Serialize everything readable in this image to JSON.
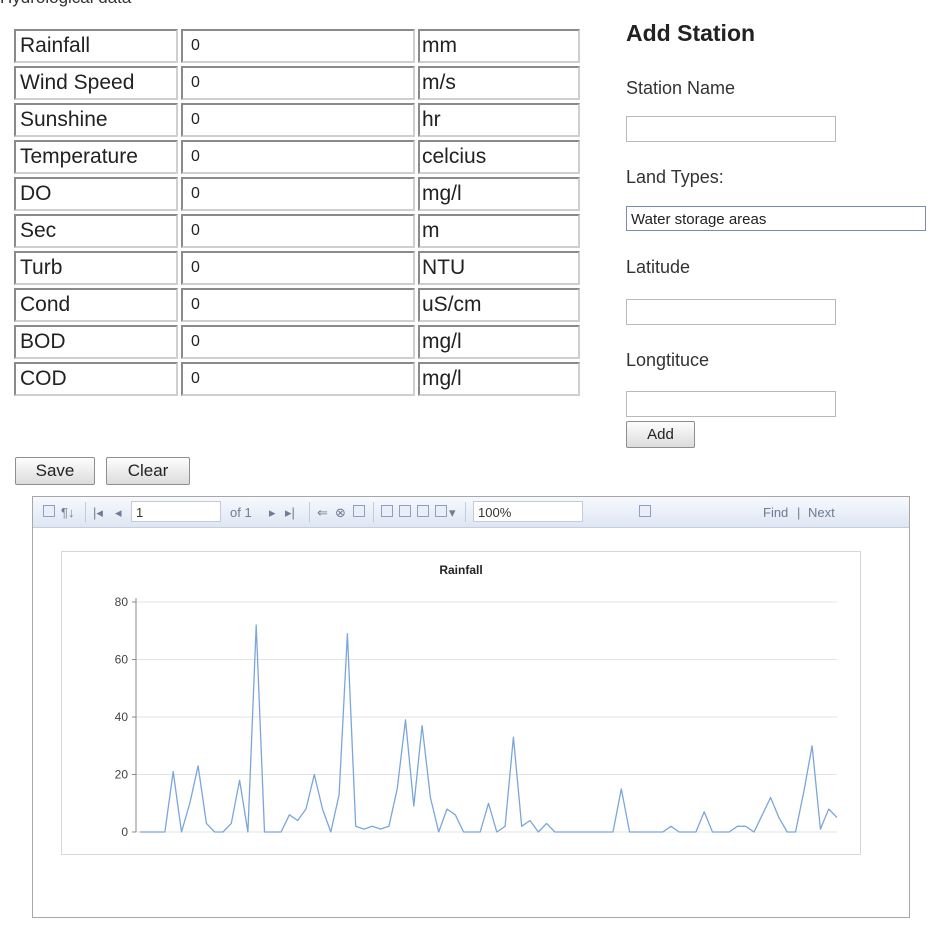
{
  "page": {
    "heading": "Hydrological data"
  },
  "parameters": [
    {
      "name": "Rainfall",
      "value": "0",
      "unit": "mm"
    },
    {
      "name": "Wind Speed",
      "value": "0",
      "unit": "m/s"
    },
    {
      "name": "Sunshine",
      "value": "0",
      "unit": "hr"
    },
    {
      "name": "Temperature",
      "value": "0",
      "unit": "celcius"
    },
    {
      "name": "DO",
      "value": "0",
      "unit": "mg/l"
    },
    {
      "name": "Sec",
      "value": "0",
      "unit": "m"
    },
    {
      "name": "Turb",
      "value": "0",
      "unit": "NTU"
    },
    {
      "name": "Cond",
      "value": "0",
      "unit": "uS/cm"
    },
    {
      "name": "BOD",
      "value": "0",
      "unit": "mg/l"
    },
    {
      "name": "COD",
      "value": "0",
      "unit": "mg/l"
    }
  ],
  "form_buttons": {
    "save": "Save",
    "clear": "Clear"
  },
  "station": {
    "title": "Add Station",
    "name_label": "Station Name",
    "name_value": "",
    "land_label": "Land Types:",
    "land_selected": "Water storage areas",
    "lat_label": "Latitude",
    "lat_value": "",
    "lon_label": "Longtituce",
    "lon_value": "",
    "add_label": "Add"
  },
  "toolbar": {
    "page": "1",
    "of_text": "of 1",
    "zoom": "100%",
    "find": "Find",
    "next": "Next",
    "separator": "|"
  },
  "chart_data": {
    "type": "line",
    "title": "Rainfall",
    "xlabel": "",
    "ylabel": "",
    "ylim": [
      0,
      80
    ],
    "yticks": [
      "0",
      "20",
      "40",
      "60",
      "80"
    ],
    "grid": true,
    "line_color": "#7ba6dc",
    "series": [
      {
        "values": [
          0,
          0,
          0,
          0,
          21,
          0,
          10,
          23,
          3,
          0,
          0,
          3,
          18,
          0,
          72,
          0,
          0,
          0,
          6,
          4,
          8,
          20,
          8,
          0,
          13,
          69,
          2,
          1,
          2,
          1,
          2,
          15,
          39,
          9,
          37,
          12,
          0,
          8,
          6,
          0,
          0,
          0,
          10,
          0,
          2,
          33,
          2,
          4,
          0,
          3,
          0,
          0,
          0,
          0,
          0,
          0,
          0,
          0,
          15,
          0,
          0,
          0,
          0,
          0,
          2,
          0,
          0,
          0,
          7,
          0,
          0,
          0,
          2,
          2,
          0,
          6,
          12,
          5,
          0,
          0,
          14,
          30,
          1,
          8,
          5
        ]
      }
    ]
  }
}
